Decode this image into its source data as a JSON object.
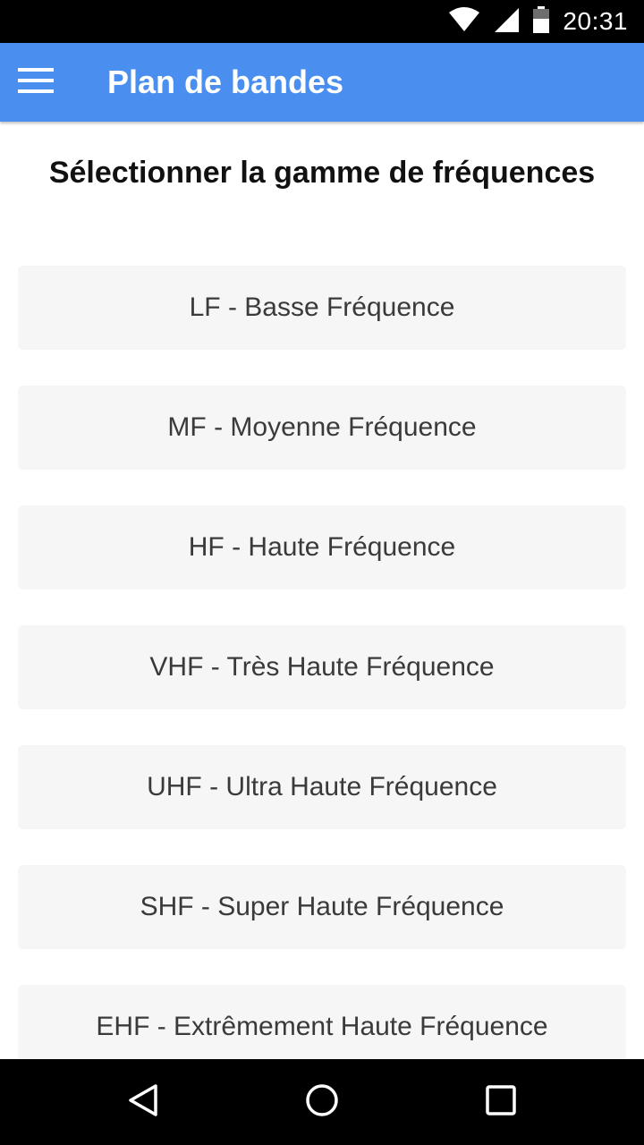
{
  "status_bar": {
    "time": "20:31",
    "icons": [
      "wifi-icon",
      "cell-signal-icon",
      "battery-icon"
    ]
  },
  "app_bar": {
    "title": "Plan de bandes",
    "menu_icon": "hamburger-menu-icon",
    "background_color": "#4a8ef0"
  },
  "main": {
    "heading": "Sélectionner la gamme de fréquences",
    "bands": [
      {
        "label": "LF - Basse Fréquence"
      },
      {
        "label": "MF - Moyenne Fréquence"
      },
      {
        "label": "HF - Haute Fréquence"
      },
      {
        "label": "VHF - Très Haute Fréquence"
      },
      {
        "label": "UHF - Ultra Haute Fréquence"
      },
      {
        "label": "SHF - Super Haute Fréquence"
      },
      {
        "label": "EHF - Extrêmement Haute Fréquence"
      }
    ]
  },
  "nav_bar": {
    "buttons": [
      "back-icon",
      "home-icon",
      "recents-icon"
    ]
  }
}
